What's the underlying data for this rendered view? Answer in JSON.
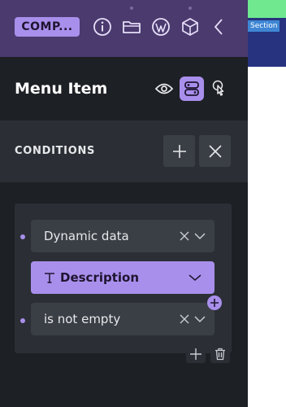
{
  "toolbar": {
    "component_label": "COMP..."
  },
  "icons": {
    "info": "info-icon",
    "folder": "folder-icon",
    "wordpress": "wordpress-icon",
    "box": "box-icon",
    "back": "chevron-left-icon",
    "eye": "eye-icon",
    "toggle": "toggle-icon",
    "pointer": "pointer-icon",
    "add": "plus-icon",
    "close": "close-icon",
    "trash": "trash-icon"
  },
  "header": {
    "title": "Menu Item"
  },
  "conditions": {
    "label": "CONDITIONS"
  },
  "condition": {
    "source": "Dynamic data",
    "field": "Description",
    "operator": "is not empty"
  },
  "canvas": {
    "section_tag": "Section"
  },
  "colors": {
    "accent": "#a98fec",
    "topbar": "#4a3a6e",
    "panel": "#1d2024",
    "surface": "#2b2f35",
    "field": "#3a3f46",
    "canvas_green": "#6fe890",
    "canvas_navy": "#27337e",
    "section_tag": "#3e86d4"
  }
}
